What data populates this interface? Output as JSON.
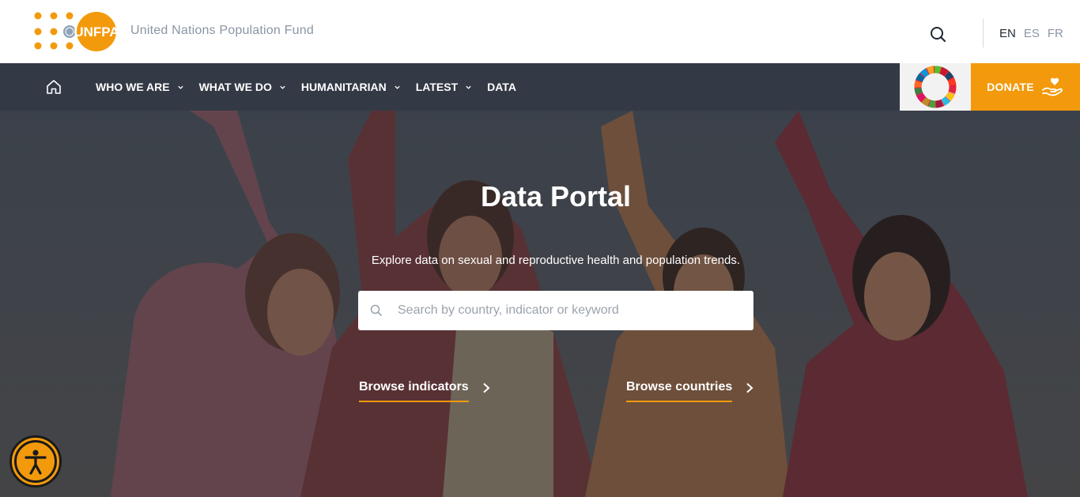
{
  "header": {
    "org_name": "United Nations Population Fund",
    "logo_wordmark": "UNFPA",
    "languages": [
      {
        "code": "EN",
        "active": true
      },
      {
        "code": "ES",
        "active": false
      },
      {
        "code": "FR",
        "active": false
      }
    ]
  },
  "nav": {
    "items": [
      {
        "label": "WHO WE ARE",
        "has_dropdown": true
      },
      {
        "label": "WHAT WE DO",
        "has_dropdown": true
      },
      {
        "label": "HUMANITARIAN",
        "has_dropdown": true
      },
      {
        "label": "LATEST",
        "has_dropdown": true
      },
      {
        "label": "DATA",
        "has_dropdown": false
      }
    ],
    "donate_label": "DONATE"
  },
  "hero": {
    "title": "Data Portal",
    "subtitle": "Explore data on sexual and reproductive health and population trends.",
    "search_placeholder": "Search by country, indicator or keyword",
    "browse_indicators": "Browse indicators",
    "browse_countries": "Browse countries"
  },
  "colors": {
    "brand_orange": "#f39a0c",
    "nav_bg": "#343a45",
    "muted_text": "#8a96a3"
  },
  "icons": [
    "unfpa-logo",
    "search-icon",
    "home-icon",
    "chevron-down-icon",
    "sdg-wheel-icon",
    "donate-hand-heart-icon",
    "chevron-right-icon",
    "accessibility-icon"
  ]
}
